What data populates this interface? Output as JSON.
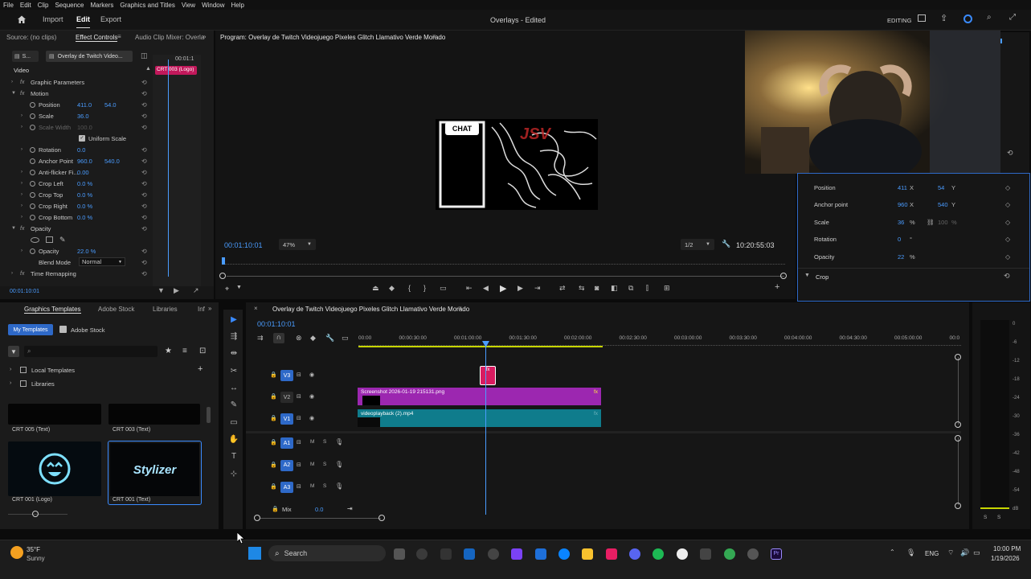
{
  "menu": [
    "File",
    "Edit",
    "Clip",
    "Sequence",
    "Markers",
    "Graphics and Titles",
    "View",
    "Window",
    "Help"
  ],
  "header": {
    "workspaces": [
      "Import",
      "Edit",
      "Export"
    ],
    "active_workspace": "Edit",
    "doc_title": "Overlays - Edited",
    "editing_label": "EDITING"
  },
  "effect_controls": {
    "tabs": [
      "Source: (no clips)",
      "Effect Controls",
      "Audio Clip Mixer: Overla"
    ],
    "master_short": "S...",
    "clip_name": "Overlay de Twitch Video...",
    "mini_time": "00:01:1",
    "clip_flag": "CRT 003 (Logo)",
    "section_video": "Video",
    "rows": [
      {
        "label": "Graphic Parameters",
        "value": "",
        "value2": ""
      },
      {
        "label": "Motion",
        "value": "",
        "value2": ""
      },
      {
        "label": "Position",
        "value": "411.0",
        "value2": "54.0"
      },
      {
        "label": "Scale",
        "value": "36.0",
        "value2": ""
      },
      {
        "label": "Scale Width",
        "value": "100.0",
        "value2": ""
      },
      {
        "label": "Uniform Scale",
        "value": "",
        "value2": ""
      },
      {
        "label": "Rotation",
        "value": "0.0",
        "value2": ""
      },
      {
        "label": "Anchor Point",
        "value": "960.0",
        "value2": "540.0"
      },
      {
        "label": "Anti-flicker Fi...",
        "value": "0.00",
        "value2": ""
      },
      {
        "label": "Crop Left",
        "value": "0.0 %",
        "value2": ""
      },
      {
        "label": "Crop Top",
        "value": "0.0 %",
        "value2": ""
      },
      {
        "label": "Crop Right",
        "value": "0.0 %",
        "value2": ""
      },
      {
        "label": "Crop Bottom",
        "value": "0.0 %",
        "value2": ""
      },
      {
        "label": "Opacity",
        "value": "",
        "value2": ""
      },
      {
        "label": "Opacity",
        "value": "22.0 %",
        "value2": ""
      },
      {
        "label": "Blend Mode",
        "value": "Normal",
        "value2": ""
      },
      {
        "label": "Time Remapping",
        "value": "",
        "value2": ""
      }
    ],
    "footer_time": "00:01:10:01"
  },
  "program": {
    "title": "Program: Overlay de Twitch Videojuego Pixeles Glitch Llamativo Verde Morado",
    "chat_label": "CHAT",
    "timecode": "00:01:10:01",
    "zoom": "47%",
    "resolution": "1/2",
    "duration": "10:20:55:03"
  },
  "properties": {
    "rows": [
      {
        "label": "Position",
        "v1": "411",
        "u1": "X",
        "v2": "54",
        "u2": "Y"
      },
      {
        "label": "Anchor point",
        "v1": "960",
        "u1": "X",
        "v2": "540",
        "u2": "Y"
      },
      {
        "label": "Scale",
        "v1": "36",
        "u1": "%",
        "v2": "100",
        "u2": "%"
      },
      {
        "label": "Rotation",
        "v1": "0",
        "u1": "°",
        "v2": "",
        "u2": ""
      },
      {
        "label": "Opacity",
        "v1": "22",
        "u1": "%",
        "v2": "",
        "u2": ""
      }
    ],
    "crop_label": "Crop"
  },
  "graphics_templates": {
    "tabs": [
      "Graphics Templates",
      "Adobe Stock",
      "Libraries",
      "Inf"
    ],
    "subtabs": [
      "My Templates",
      "Adobe Stock"
    ],
    "search_placeholder": "",
    "folders": [
      "Local Templates",
      "Libraries"
    ],
    "items": [
      {
        "label": "CRT 005 (Text)",
        "preview": ""
      },
      {
        "label": "CRT 003 (Text)",
        "preview": ""
      },
      {
        "label": "CRT 001 (Logo)",
        "preview": ""
      },
      {
        "label": "CRT 001 (Text)",
        "preview": "Stylizer"
      }
    ]
  },
  "timeline": {
    "sequence_name": "Overlay de Twitch Videojuego Pixeles Glitch Llamativo Verde Morado",
    "timecode": "00:01:10:01",
    "ruler": [
      "00:00",
      "00:00:30:00",
      "00:01:00:00",
      "00:01:30:00",
      "00:02:00:00",
      "00:02:30:00",
      "00:03:00:00",
      "00:03:30:00",
      "00:04:00:00",
      "00:04:30:00",
      "00:05:00:00",
      "00:0"
    ],
    "video_tracks": [
      "V3",
      "V2",
      "V1"
    ],
    "audio_tracks": [
      "A1",
      "A2",
      "A3"
    ],
    "clip_v2": "Screenshot 2026-01-19 215131.png",
    "clip_v1": "videoplayback (2).mp4",
    "clip_fx": "fx",
    "mix_label": "Mix",
    "mix_value": "0.0",
    "track_m": "M",
    "track_s": "S"
  },
  "meter_ticks": [
    "0",
    "-6",
    "-12",
    "-18",
    "-24",
    "-30",
    "-36",
    "-42",
    "-48",
    "-54",
    "dB"
  ],
  "meter_footer": [
    "S",
    "S"
  ],
  "taskbar": {
    "weather_temp": "35°F",
    "weather_desc": "Sunny",
    "search_label": "Search",
    "lang": "ENG",
    "time": "10:00 PM",
    "date": "1/19/2026"
  },
  "colors": {
    "accent_blue": "#2e69c8",
    "timecode_blue": "#4a9cff",
    "clip_purple": "#9c27b0",
    "clip_teal": "#0f7c8c",
    "playhead": "#4a9cff",
    "flag_red": "#c2185b"
  }
}
